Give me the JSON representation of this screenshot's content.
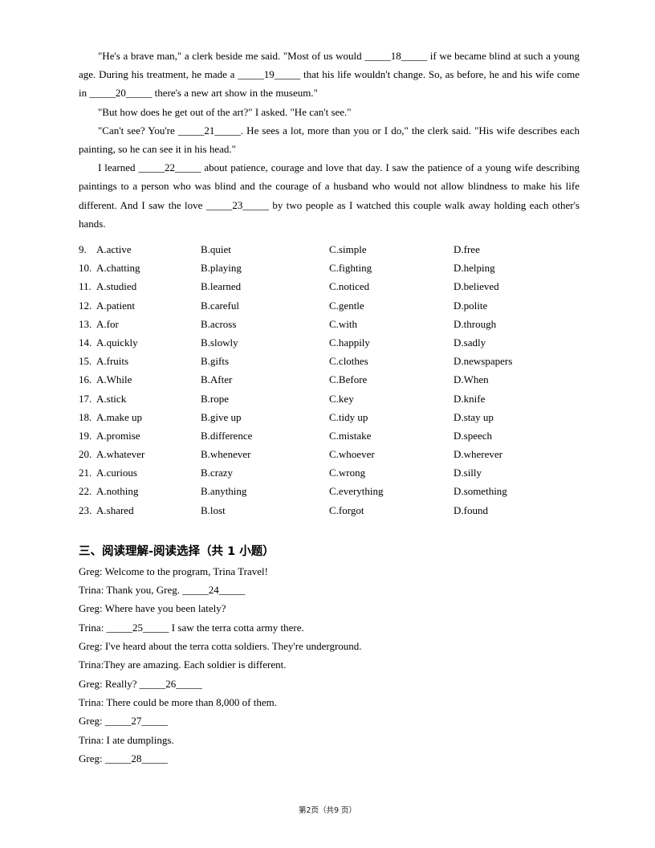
{
  "document": {
    "passage_paragraphs": [
      "\"He's a brave man,\" a clerk beside me said. \"Most of us would _____18_____ if we became blind at such a young age. During his treatment, he made a _____19_____ that his life wouldn't change. So, as before, he and his wife come in _____20_____ there's a new art show in the museum.\"",
      "\"But how does he get out of the art?\" I asked. \"He can't see.\"",
      "\"Can't see? You're _____21_____. He sees a lot, more than you or I do,\" the clerk said. \"His wife describes each painting, so he can see it in his head.\"",
      "I learned _____22_____ about patience, courage and love that day. I saw the patience of a young wife describing paintings to a person who was blind and the courage of a husband who would not allow blindness to make his life different. And I saw the love _____23_____ by two people as I watched this couple walk away holding each other's hands."
    ],
    "options": [
      {
        "num": "9.",
        "a": "A.active",
        "b": "B.quiet",
        "c": "C.simple",
        "d": "D.free"
      },
      {
        "num": "10.",
        "a": "A.chatting",
        "b": "B.playing",
        "c": "C.fighting",
        "d": "D.helping"
      },
      {
        "num": "11.",
        "a": "A.studied",
        "b": "B.learned",
        "c": "C.noticed",
        "d": "D.believed"
      },
      {
        "num": "12.",
        "a": "A.patient",
        "b": "B.careful",
        "c": "C.gentle",
        "d": "D.polite"
      },
      {
        "num": "13.",
        "a": "A.for",
        "b": "B.across",
        "c": "C.with",
        "d": "D.through"
      },
      {
        "num": "14.",
        "a": "A.quickly",
        "b": "B.slowly",
        "c": "C.happily",
        "d": "D.sadly"
      },
      {
        "num": "15.",
        "a": "A.fruits",
        "b": "B.gifts",
        "c": "C.clothes",
        "d": "D.newspapers"
      },
      {
        "num": "16.",
        "a": "A.While",
        "b": "B.After",
        "c": "C.Before",
        "d": "D.When"
      },
      {
        "num": "17.",
        "a": "A.stick",
        "b": "B.rope",
        "c": "C.key",
        "d": "D.knife"
      },
      {
        "num": "18.",
        "a": "A.make up",
        "b": "B.give up",
        "c": "C.tidy up",
        "d": "D.stay up"
      },
      {
        "num": "19.",
        "a": "A.promise",
        "b": "B.difference",
        "c": "C.mistake",
        "d": "D.speech"
      },
      {
        "num": "20.",
        "a": "A.whatever",
        "b": "B.whenever",
        "c": "C.whoever",
        "d": "D.wherever"
      },
      {
        "num": "21.",
        "a": "A.curious",
        "b": "B.crazy",
        "c": "C.wrong",
        "d": "D.silly"
      },
      {
        "num": "22.",
        "a": "A.nothing",
        "b": "B.anything",
        "c": "C.everything",
        "d": "D.something"
      },
      {
        "num": "23.",
        "a": "A.shared",
        "b": "B.lost",
        "c": "C.forgot",
        "d": "D.found"
      }
    ],
    "section_heading": "三、阅读理解-阅读选择（共 1 小题）",
    "dialogue_lines": [
      "Greg: Welcome to the program, Trina Travel!",
      "Trina: Thank you, Greg. _____24_____",
      "Greg: Where have you been lately?",
      "Trina: _____25_____ I saw the terra cotta army there.",
      "Greg: I've heard about the terra cotta soldiers. They're underground.",
      "Trina:They are amazing. Each soldier is different.",
      "Greg: Really? _____26_____",
      "Trina: There could be more than 8,000 of them.",
      "Greg: _____27_____",
      "Trina: I ate dumplings.",
      "Greg: _____28_____"
    ],
    "footer": "第2页（共9 页）"
  }
}
